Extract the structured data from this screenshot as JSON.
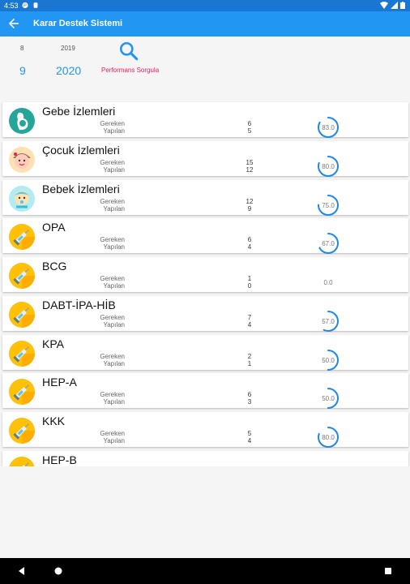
{
  "status_bar": {
    "time": "4:53"
  },
  "app_bar": {
    "title": "Karar Destek Sistemi"
  },
  "query": {
    "month_prev": "8",
    "year_prev": "2019",
    "month": "9",
    "year": "2020",
    "search_label": "Performans Sorgula"
  },
  "labels": {
    "required": "Gereken",
    "done": "Yapılan"
  },
  "items": [
    {
      "name": "Gebe İzlemleri",
      "required": "6",
      "done": "5",
      "score": "83.0",
      "icon": "pregnant-woman-icon"
    },
    {
      "name": "Çocuk İzlemleri",
      "required": "15",
      "done": "12",
      "score": "80.0",
      "icon": "child-icon"
    },
    {
      "name": "Bebek İzlemleri",
      "required": "12",
      "done": "9",
      "score": "75.0",
      "icon": "baby-icon"
    },
    {
      "name": "OPA",
      "required": "6",
      "done": "4",
      "score": "67.0",
      "icon": "syringe-icon"
    },
    {
      "name": "BCG",
      "required": "1",
      "done": "0",
      "score": "0.0",
      "icon": "syringe-icon"
    },
    {
      "name": "DABT-İPA-HİB",
      "required": "7",
      "done": "4",
      "score": "57.0",
      "icon": "syringe-icon"
    },
    {
      "name": "KPA",
      "required": "2",
      "done": "1",
      "score": "50.0",
      "icon": "syringe-icon"
    },
    {
      "name": "HEP-A",
      "required": "6",
      "done": "3",
      "score": "50.0",
      "icon": "syringe-icon"
    },
    {
      "name": "KKK",
      "required": "5",
      "done": "4",
      "score": "80.0",
      "icon": "syringe-icon"
    },
    {
      "name": "HEP-B",
      "required": "",
      "done": "",
      "score": "",
      "icon": "syringe-icon"
    }
  ],
  "colors": {
    "primary": "#2196f3",
    "status": "#1976d2",
    "accent": "#e91e63",
    "vaccine": "#ffc107"
  }
}
